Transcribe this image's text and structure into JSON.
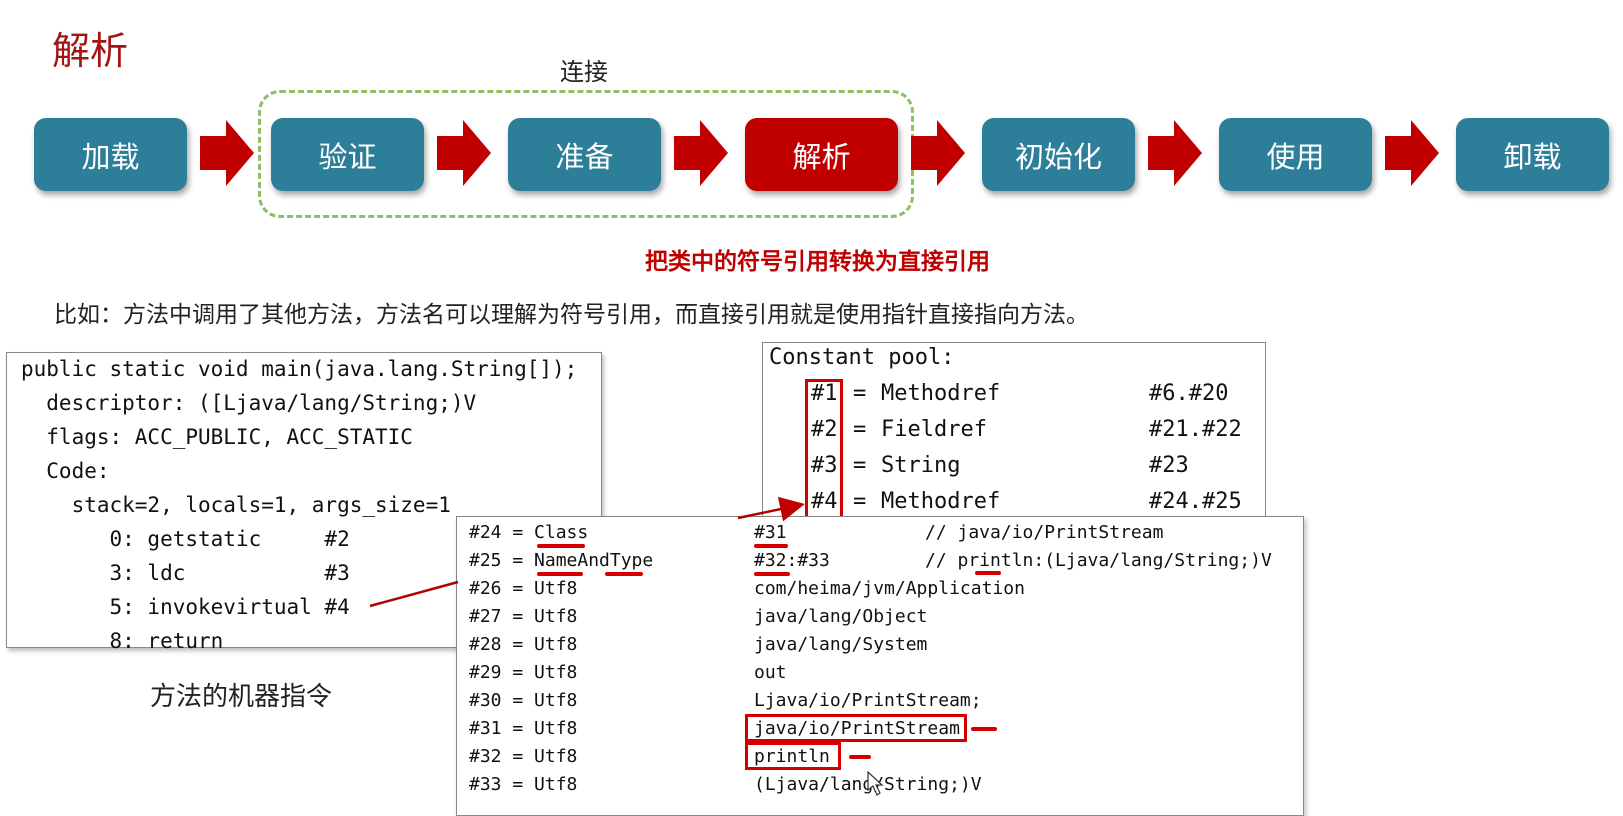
{
  "title": "解析",
  "group_label": "连接",
  "stages": [
    "加载",
    "验证",
    "准备",
    "解析",
    "初始化",
    "使用",
    "卸载"
  ],
  "active_stage": "解析",
  "description": "把类中的符号引用转换为直接引用",
  "example": "比如：方法中调用了其他方法，方法名可以理解为符号引用，而直接引用就是使用指针直接指向方法。",
  "method_code": [
    "public static void main(java.lang.String[]);",
    "  descriptor: ([Ljava/lang/String;)V",
    "  flags: ACC_PUBLIC, ACC_STATIC",
    "  Code:",
    "    stack=2, locals=1, args_size=1",
    "       0: getstatic     #2",
    "       3: ldc           #3",
    "       5: invokevirtual #4",
    "       8: return"
  ],
  "caption": "方法的机器指令",
  "constant_pool": {
    "header": "Constant pool:",
    "entries": [
      {
        "id": "#1",
        "type": "Methodref",
        "ref": "#6.#20"
      },
      {
        "id": "#2",
        "type": "Fieldref",
        "ref": "#21.#22"
      },
      {
        "id": "#3",
        "type": "String",
        "ref": "#23"
      },
      {
        "id": "#4",
        "type": "Methodref",
        "ref": "#24.#25"
      }
    ]
  },
  "pool_detail": [
    {
      "left": "#24 = Class",
      "mid": "#31",
      "comment": "// java/io/PrintStream"
    },
    {
      "left": "#25 = NameAndType",
      "mid": "#32:#33",
      "comment": "// println:(Ljava/lang/String;)V"
    },
    {
      "left": "#26 = Utf8",
      "mid": "com/heima/jvm/Application",
      "comment": ""
    },
    {
      "left": "#27 = Utf8",
      "mid": "java/lang/Object",
      "comment": ""
    },
    {
      "left": "#28 = Utf8",
      "mid": "java/lang/System",
      "comment": ""
    },
    {
      "left": "#29 = Utf8",
      "mid": "out",
      "comment": ""
    },
    {
      "left": "#30 = Utf8",
      "mid": "Ljava/io/PrintStream;",
      "comment": ""
    },
    {
      "left": "#31 = Utf8",
      "mid": "java/io/PrintStream",
      "comment": ""
    },
    {
      "left": "#32 = Utf8",
      "mid": "println",
      "comment": ""
    },
    {
      "left": "#33 = Utf8",
      "mid": "(Ljava/lang/String;)V",
      "comment": ""
    }
  ],
  "colors": {
    "stage": "#2d7f99",
    "active_stage": "#c00000",
    "arrow": "#c00000",
    "group_border": "#8cc062",
    "highlight": "#d40000"
  }
}
